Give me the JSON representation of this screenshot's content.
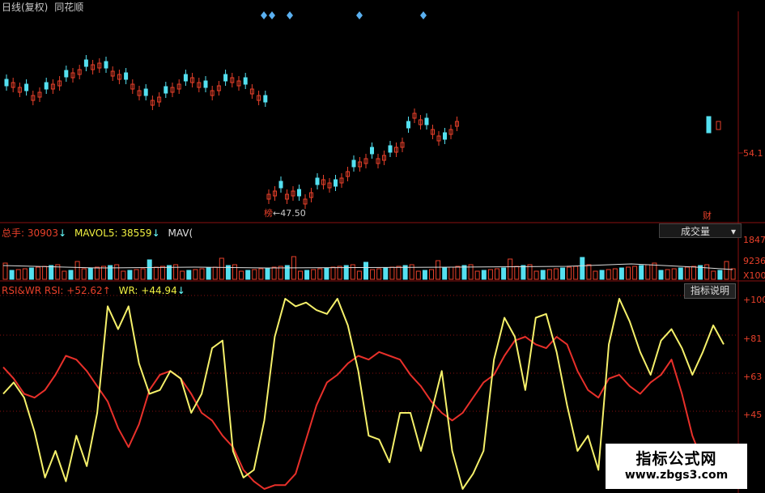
{
  "header": {
    "title": "日线(复权)",
    "app_name": "同花顺"
  },
  "price_panel": {
    "low_marker_char": "榜",
    "low_label": "←47.50",
    "right_axis_label": "54.1",
    "event_marker_char": "财",
    "diamond_markers": 5
  },
  "volume_panel": {
    "total_label": "总手:",
    "total_value": "30903",
    "mavol5_label": "MAVOL5:",
    "mavol5_value": "38559",
    "mavol10_label": "MAV(",
    "selector_label": "成交量",
    "axis_labels": [
      "1847",
      "9236",
      "X100"
    ]
  },
  "indicator_panel": {
    "name": "RSI&WR",
    "rsi_label": "RSI:",
    "rsi_value": "+52.62",
    "wr_label": "WR:",
    "wr_value": "+44.94",
    "help_button": "指标说明",
    "axis_labels": [
      "+100",
      "+81",
      "+63",
      "+45"
    ]
  },
  "watermark": {
    "line1": "指标公式网",
    "line2": "www.zbgs3.com"
  },
  "colors": {
    "up": "#e8402a",
    "down": "#54e0f0",
    "rsi": "#e8302a",
    "wr": "#f5f06a",
    "grid": "#8a1010",
    "background": "#000000"
  },
  "chart_data": {
    "type": "line",
    "series": [
      {
        "name": "RSI",
        "values": [
          64,
          58,
          50,
          48,
          52,
          60,
          70,
          68,
          62,
          54,
          46,
          32,
          22,
          34,
          52,
          60,
          62,
          58,
          50,
          40,
          36,
          28,
          22,
          10,
          4,
          0,
          2,
          2,
          8,
          26,
          44,
          56,
          60,
          66,
          70,
          68,
          72,
          70,
          68,
          60,
          54,
          46,
          40,
          36,
          40,
          48,
          56,
          60,
          70,
          78,
          80,
          76,
          74,
          80,
          76,
          62,
          52,
          48,
          58,
          60,
          54,
          50,
          56,
          60,
          68,
          50,
          28,
          14,
          10,
          6
        ]
      },
      {
        "name": "WR",
        "values": [
          50,
          56,
          48,
          30,
          6,
          20,
          4,
          28,
          12,
          40,
          96,
          84,
          96,
          66,
          50,
          52,
          62,
          58,
          40,
          50,
          74,
          78,
          20,
          6,
          10,
          36,
          80,
          100,
          96,
          98,
          94,
          92,
          100,
          86,
          62,
          28,
          26,
          14,
          40,
          40,
          20,
          40,
          62,
          20,
          0,
          8,
          20,
          68,
          90,
          80,
          52,
          90,
          92,
          72,
          44,
          20,
          28,
          10,
          76,
          100,
          88,
          72,
          60,
          78,
          84,
          74,
          60,
          72,
          86,
          76
        ]
      }
    ],
    "ylim": [
      0,
      100
    ]
  }
}
